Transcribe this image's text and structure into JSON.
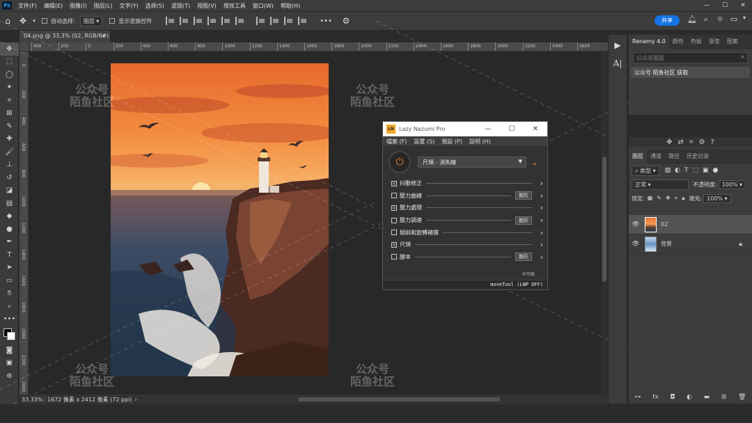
{
  "menubar": {
    "items": [
      "文件(F)",
      "编辑(E)",
      "图像(I)",
      "图层(L)",
      "文字(Y)",
      "选择(S)",
      "滤镜(T)",
      "视图(V)",
      "增效工具",
      "窗口(W)",
      "帮助(H)"
    ],
    "win_min": "—",
    "win_max": "☐",
    "win_close": "✕"
  },
  "optbar": {
    "auto_select": "自动选择:",
    "layer_select": "图层",
    "show_transform": "显示变换控件",
    "more": "•••",
    "share": "共享"
  },
  "document": {
    "tab_title": "04.png @ 33.3% (02, RGB/8#) *",
    "close": "×",
    "zoom": "33.33%",
    "dimensions": "1672 像素 x 2412 像素 (72 ppi)"
  },
  "ruler": {
    "top": [
      "400",
      "200",
      "0",
      "200",
      "400",
      "600",
      "800",
      "1000",
      "1200",
      "1400",
      "1600",
      "1800",
      "2000",
      "2200",
      "2400",
      "2600",
      "2800",
      "3000",
      "3200",
      "3400",
      "3600"
    ],
    "left": [
      "0",
      "200",
      "400",
      "600",
      "800",
      "1000",
      "1200",
      "1400",
      "1600",
      "1800",
      "2000",
      "2200",
      "2400"
    ]
  },
  "watermark": {
    "line1": "公众号",
    "line2": "陌鱼社区"
  },
  "renamy": {
    "tabs": [
      "Renamy 4.0",
      "颜色",
      "色板",
      "渐变",
      "图案"
    ],
    "search_placeholder": "公众名图层",
    "row": "公众号 陌鱼社区 获取"
  },
  "layers": {
    "tabs": [
      "图层",
      "通道",
      "路径",
      "历史记录"
    ],
    "kind": "类型",
    "blend": "正常",
    "opacity_label": "不透明度:",
    "opacity": "100%",
    "lock_label": "锁定:",
    "fill_label": "填充:",
    "fill": "100%",
    "items": [
      {
        "name": "02"
      },
      {
        "name": "背景"
      }
    ]
  },
  "lazy_nezumi": {
    "title": "Lazy Nezumi Pro",
    "logo": "LN",
    "menu": [
      "檔案 (F)",
      "設置 (S)",
      "預設 (P)",
      "說明 (H)"
    ],
    "preset": "尺規 - 消失線",
    "rows": [
      {
        "label": "抖動修正",
        "checked": true,
        "button": ""
      },
      {
        "label": "壓力曲線",
        "checked": false,
        "button": "圖形"
      },
      {
        "label": "壓力處理",
        "checked": true,
        "button": ""
      },
      {
        "label": "壓力調速",
        "checked": false,
        "button": "圖形"
      },
      {
        "label": "傾斜和旋轉補償",
        "checked": false,
        "button": ""
      },
      {
        "label": "尺規",
        "checked": true,
        "button": ""
      },
      {
        "label": "腳本",
        "checked": false,
        "button": "圖形"
      }
    ],
    "note": "科可離",
    "status": "moveTool (LNP OFF)"
  },
  "colors": {
    "accent": "#1473e6",
    "ln_orange": "#e07a26"
  }
}
